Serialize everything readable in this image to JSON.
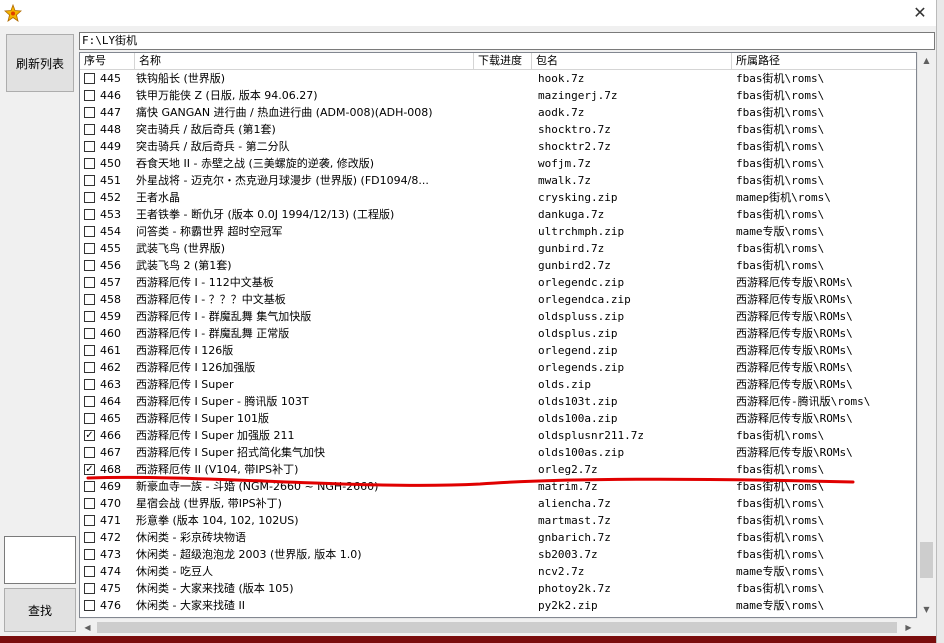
{
  "toolbar": {
    "refresh_label": "刷新列表",
    "search_label": "查找"
  },
  "path": {
    "value": "F:\\LY街机"
  },
  "columns": [
    "序号",
    "名称",
    "下载进度",
    "包名",
    "所属路径"
  ],
  "rows": [
    {
      "checked": false,
      "num": "445",
      "name": "铁钩船长 (世界版)",
      "zip": "hook.7z",
      "path": "fbas街机\\roms\\"
    },
    {
      "checked": false,
      "num": "446",
      "name": "铁甲万能侠 Z (日版, 版本 94.06.27)",
      "zip": "mazingerj.7z",
      "path": "fbas街机\\roms\\"
    },
    {
      "checked": false,
      "num": "447",
      "name": "痛快 GANGAN 进行曲 / 热血进行曲 (ADM-008)(ADH-008)",
      "zip": "aodk.7z",
      "path": "fbas街机\\roms\\"
    },
    {
      "checked": false,
      "num": "448",
      "name": "突击骑兵 / 敌后奇兵 (第1套)",
      "zip": "shocktro.7z",
      "path": "fbas街机\\roms\\"
    },
    {
      "checked": false,
      "num": "449",
      "name": "突击骑兵 / 敌后奇兵 - 第二分队",
      "zip": "shocktr2.7z",
      "path": "fbas街机\\roms\\"
    },
    {
      "checked": false,
      "num": "450",
      "name": "吞食天地 II - 赤壁之战 (三美螺旋的逆袭, 修改版)",
      "zip": "wofjm.7z",
      "path": "fbas街机\\roms\\"
    },
    {
      "checked": false,
      "num": "451",
      "name": "外星战将 - 迈克尔・杰克逊月球漫步 (世界版) (FD1094/8...",
      "zip": "mwalk.7z",
      "path": "fbas街机\\roms\\"
    },
    {
      "checked": false,
      "num": "452",
      "name": "王者水晶",
      "zip": "crysking.zip",
      "path": "mamep街机\\roms\\"
    },
    {
      "checked": false,
      "num": "453",
      "name": "王者铁拳 - 断仇牙 (版本 0.0J 1994/12/13) (工程版)",
      "zip": "dankuga.7z",
      "path": "fbas街机\\roms\\"
    },
    {
      "checked": false,
      "num": "454",
      "name": "问答类 - 称霸世界 超时空冠军",
      "zip": "ultrchmph.zip",
      "path": "mame专版\\roms\\"
    },
    {
      "checked": false,
      "num": "455",
      "name": "武装飞鸟 (世界版)",
      "zip": "gunbird.7z",
      "path": "fbas街机\\roms\\"
    },
    {
      "checked": false,
      "num": "456",
      "name": "武装飞鸟 2 (第1套)",
      "zip": "gunbird2.7z",
      "path": "fbas街机\\roms\\"
    },
    {
      "checked": false,
      "num": "457",
      "name": "西游释厄传 I - 112中文基板",
      "zip": "orlegendc.zip",
      "path": "西游释厄传专版\\ROMs\\"
    },
    {
      "checked": false,
      "num": "458",
      "name": "西游释厄传 I - ？？？中文基板",
      "zip": "orlegendca.zip",
      "path": "西游释厄传专版\\ROMs\\"
    },
    {
      "checked": false,
      "num": "459",
      "name": "西游释厄传 I - 群魔乱舞 集气加快版",
      "zip": "oldspluss.zip",
      "path": "西游释厄传专版\\ROMs\\"
    },
    {
      "checked": false,
      "num": "460",
      "name": "西游释厄传 I - 群魔乱舞 正常版",
      "zip": "oldsplus.zip",
      "path": "西游释厄传专版\\ROMs\\"
    },
    {
      "checked": false,
      "num": "461",
      "name": "西游释厄传 I 126版",
      "zip": "orlegend.zip",
      "path": "西游释厄传专版\\ROMs\\"
    },
    {
      "checked": false,
      "num": "462",
      "name": "西游释厄传 I 126加强版",
      "zip": "orlegends.zip",
      "path": "西游释厄传专版\\ROMs\\"
    },
    {
      "checked": false,
      "num": "463",
      "name": "西游释厄传 I Super",
      "zip": "olds.zip",
      "path": "西游释厄传专版\\ROMs\\"
    },
    {
      "checked": false,
      "num": "464",
      "name": "西游释厄传 I Super - 腾讯版 103T",
      "zip": "olds103t.zip",
      "path": "西游释厄传-腾讯版\\roms\\"
    },
    {
      "checked": false,
      "num": "465",
      "name": "西游释厄传 I Super 101版",
      "zip": "olds100a.zip",
      "path": "西游释厄传专版\\ROMs\\"
    },
    {
      "checked": true,
      "num": "466",
      "name": "西游释厄传 I Super 加强版 211",
      "zip": "oldsplusnr211.7z",
      "path": "fbas街机\\roms\\"
    },
    {
      "checked": false,
      "num": "467",
      "name": "西游释厄传 I Super 招式简化集气加快",
      "zip": "olds100as.zip",
      "path": "西游释厄传专版\\ROMs\\"
    },
    {
      "checked": true,
      "num": "468",
      "name": "西游释厄传 II (V104, 带IPS补丁)",
      "zip": "orleg2.7z",
      "path": "fbas街机\\roms\\"
    },
    {
      "checked": false,
      "num": "469",
      "name": "新豪血寺一族 - 斗婚 (NGM-2660 ~ NGH-2660)",
      "zip": "matrim.7z",
      "path": "fbas街机\\roms\\"
    },
    {
      "checked": false,
      "num": "470",
      "name": "星宿会战 (世界版, 带IPS补丁)",
      "zip": "aliencha.7z",
      "path": "fbas街机\\roms\\"
    },
    {
      "checked": false,
      "num": "471",
      "name": "形意拳 (版本 104, 102, 102US)",
      "zip": "martmast.7z",
      "path": "fbas街机\\roms\\"
    },
    {
      "checked": false,
      "num": "472",
      "name": "休闲类 - 彩京砖块物语",
      "zip": "gnbarich.7z",
      "path": "fbas街机\\roms\\"
    },
    {
      "checked": false,
      "num": "473",
      "name": "休闲类 - 超级泡泡龙 2003 (世界版, 版本 1.0)",
      "zip": "sb2003.7z",
      "path": "fbas街机\\roms\\"
    },
    {
      "checked": false,
      "num": "474",
      "name": "休闲类 - 吃豆人",
      "zip": "ncv2.7z",
      "path": "mame专版\\roms\\"
    },
    {
      "checked": false,
      "num": "475",
      "name": "休闲类 - 大家来找碴 (版本 105)",
      "zip": "photoy2k.7z",
      "path": "fbas街机\\roms\\"
    },
    {
      "checked": false,
      "num": "476",
      "name": "休闲类 - 大家来找碴 II",
      "zip": "py2k2.zip",
      "path": "mame专版\\roms\\"
    }
  ],
  "colors": {
    "annotation": "#e00000",
    "window_bg": "#f0f0f0"
  }
}
